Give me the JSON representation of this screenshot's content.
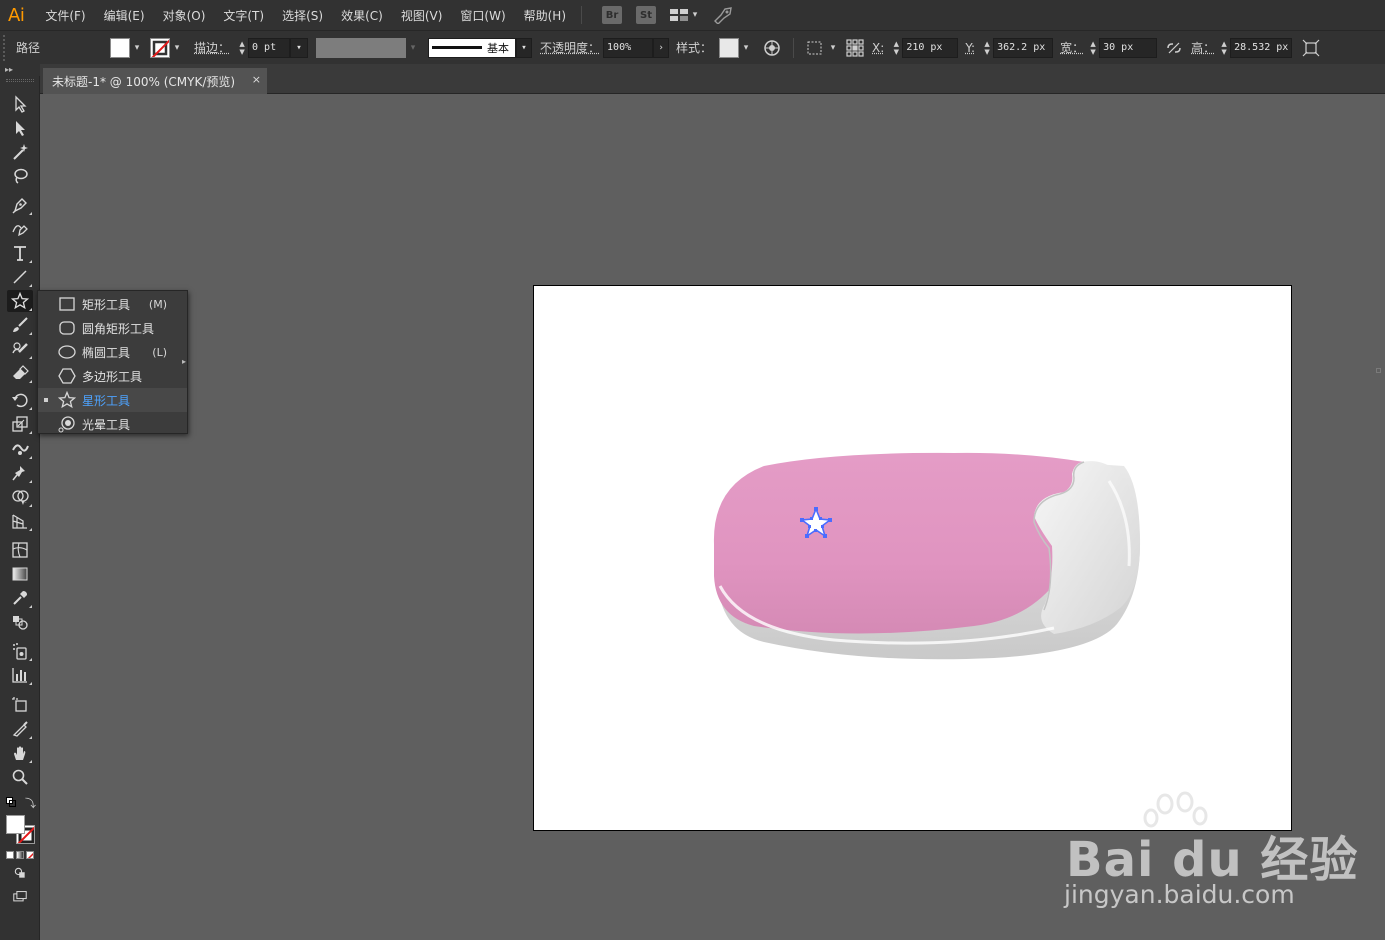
{
  "app": {
    "logo": "Ai"
  },
  "menubar": {
    "items": [
      "文件(F)",
      "编辑(E)",
      "对象(O)",
      "文字(T)",
      "选择(S)",
      "效果(C)",
      "视图(V)",
      "窗口(W)",
      "帮助(H)"
    ],
    "bridge_label": "Br",
    "stock_label": "St"
  },
  "controlbar": {
    "object_type": "路径",
    "stroke_label": "描边：",
    "stroke_weight": "0 pt",
    "stroke_profile": "基本",
    "opacity_label": "不透明度：",
    "opacity_value": "100%",
    "style_label": "样式：",
    "x_label": "X:",
    "x_value": "210 px",
    "y_label": "Y:",
    "y_value": "362.2 px",
    "w_label": "宽：",
    "w_value": "30 px",
    "h_label": "高：",
    "h_value": "28.532 px"
  },
  "document": {
    "tab_title": "未标题-1* @ 100% (CMYK/预览)",
    "close": "×"
  },
  "flyout": {
    "items": [
      {
        "label": "矩形工具",
        "shortcut": "(M)",
        "icon": "rectangle-icon"
      },
      {
        "label": "圆角矩形工具",
        "shortcut": "",
        "icon": "rounded-rectangle-icon"
      },
      {
        "label": "椭圆工具",
        "shortcut": "(L)",
        "icon": "ellipse-icon"
      },
      {
        "label": "多边形工具",
        "shortcut": "",
        "icon": "polygon-icon"
      },
      {
        "label": "星形工具",
        "shortcut": "",
        "icon": "star-icon"
      },
      {
        "label": "光晕工具",
        "shortcut": "",
        "icon": "flare-icon"
      }
    ],
    "active_index": 4
  },
  "colors": {
    "accent": "#4ea3ff",
    "logo": "#ff9a00",
    "device_pink": "#e396c3",
    "selection": "#4a6cff"
  },
  "watermark": {
    "brand": "Bai du 经验",
    "url": "jingyan.baidu.com"
  }
}
